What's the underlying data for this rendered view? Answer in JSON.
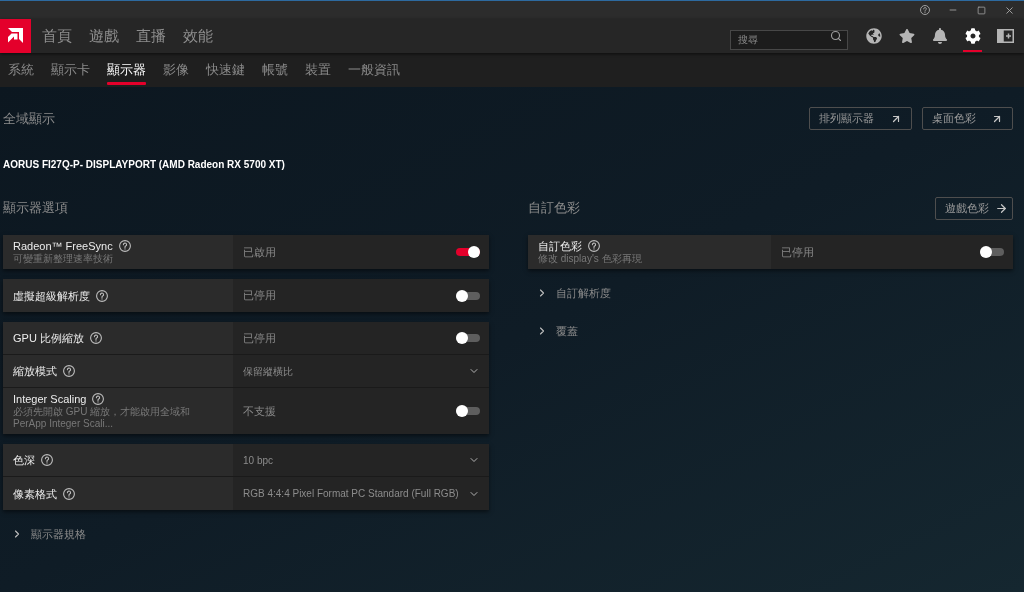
{
  "nav": {
    "tabs": [
      {
        "label": "首頁",
        "selected": false
      },
      {
        "label": "遊戲",
        "selected": false
      },
      {
        "label": "直播",
        "selected": false
      },
      {
        "label": "效能",
        "selected": false
      }
    ],
    "search": {
      "placeholder": "搜尋"
    },
    "toolbar": [
      {
        "kind": "globe",
        "selected": false
      },
      {
        "kind": "star",
        "selected": false
      },
      {
        "kind": "bell",
        "selected": false
      },
      {
        "kind": "gear",
        "selected": true
      },
      {
        "kind": "panel",
        "selected": false
      }
    ]
  },
  "subnav": {
    "tabs": [
      {
        "label": "系統",
        "selected": false
      },
      {
        "label": "顯示卡",
        "selected": false
      },
      {
        "label": "顯示器",
        "selected": true
      },
      {
        "label": "影像",
        "selected": false
      },
      {
        "label": "快速鍵",
        "selected": false
      },
      {
        "label": "帳號",
        "selected": false
      },
      {
        "label": "裝置",
        "selected": false
      },
      {
        "label": "一般資訊",
        "selected": false
      }
    ]
  },
  "global_display": {
    "title": "全域顯示",
    "buttons": [
      {
        "label": "排列顯示器",
        "kind": "external"
      },
      {
        "label": "桌面色彩",
        "kind": "external"
      }
    ],
    "monitor": "AORUS FI27Q-P- DISPLAYPORT (AMD Radeon RX 5700 XT)"
  },
  "display_options": {
    "title": "顯示器選項",
    "groups": [
      {
        "rows": [
          {
            "kind": "toggle",
            "label": "Radeon™ FreeSync",
            "sublabel": "可變重新整理速率技術",
            "value": "已啟用",
            "on": true
          }
        ]
      },
      {
        "rows": [
          {
            "kind": "toggle",
            "label": "虛擬超級解析度",
            "value": "已停用",
            "on": false
          }
        ]
      },
      {
        "rows": [
          {
            "kind": "toggle",
            "label": "GPU 比例縮放",
            "value": "已停用",
            "on": false
          },
          {
            "kind": "dropdown",
            "label": "縮放模式",
            "value": "保留縱橫比"
          },
          {
            "kind": "toggle",
            "label": "Integer Scaling",
            "sublabel": "必須先開啟 GPU 縮放，才能啟用全域和 PerApp Integer Scali...",
            "value": "不支援",
            "on": false
          }
        ]
      },
      {
        "rows": [
          {
            "kind": "dropdown",
            "label": "色深",
            "value": "10 bpc"
          },
          {
            "kind": "dropdown",
            "label": "像素格式",
            "value": "RGB 4:4:4 Pixel Format PC Standard (Full RGB)"
          }
        ]
      }
    ],
    "expanders": [
      {
        "label": "顯示器規格",
        "expanded": false
      }
    ]
  },
  "custom_color": {
    "title": "自訂色彩",
    "button": {
      "label": "遊戲色彩",
      "kind": "navigate"
    },
    "rows": [
      {
        "kind": "toggle",
        "label": "自訂色彩",
        "sublabel": "修改 display's 色彩再現",
        "value": "已停用",
        "on": false
      }
    ],
    "expanders": [
      {
        "label": "自訂解析度",
        "expanded": false
      },
      {
        "label": "覆蓋",
        "expanded": false
      }
    ]
  }
}
